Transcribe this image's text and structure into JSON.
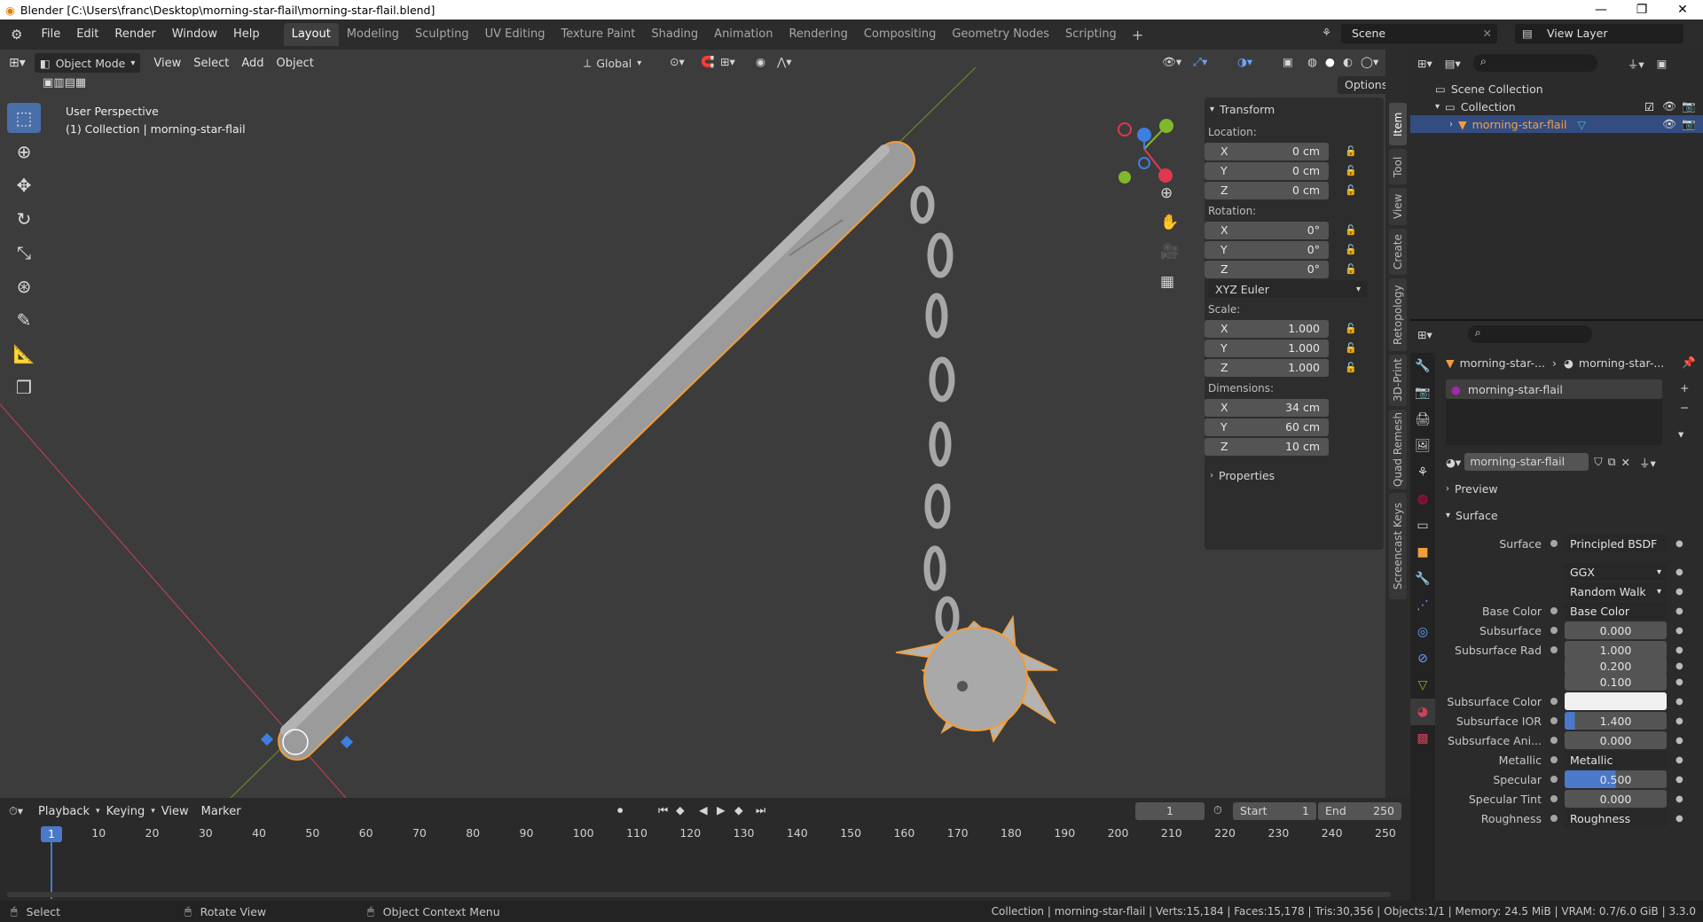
{
  "window": {
    "title": "Blender [C:\\Users\\franc\\Desktop\\morning-star-flail\\morning-star-flail.blend]"
  },
  "menu": [
    "File",
    "Edit",
    "Render",
    "Window",
    "Help"
  ],
  "workspaces": [
    "Layout",
    "Modeling",
    "Sculpting",
    "UV Editing",
    "Texture Paint",
    "Shading",
    "Animation",
    "Rendering",
    "Compositing",
    "Geometry Nodes",
    "Scripting"
  ],
  "active_workspace": "Layout",
  "scene": "Scene",
  "view_layer": "View Layer",
  "viewport": {
    "mode": "Object Mode",
    "menus": [
      "View",
      "Select",
      "Add",
      "Object"
    ],
    "orientation": "Global",
    "options": "Options",
    "overlay_title": "User Perspective",
    "overlay_sub": "(1) Collection | morning-star-flail"
  },
  "npanel": {
    "header": "Transform",
    "location_label": "Location:",
    "location": [
      {
        "axis": "X",
        "value": "0 cm"
      },
      {
        "axis": "Y",
        "value": "0 cm"
      },
      {
        "axis": "Z",
        "value": "0 cm"
      }
    ],
    "rotation_label": "Rotation:",
    "rotation": [
      {
        "axis": "X",
        "value": "0°"
      },
      {
        "axis": "Y",
        "value": "0°"
      },
      {
        "axis": "Z",
        "value": "0°"
      }
    ],
    "rotation_mode": "XYZ Euler",
    "scale_label": "Scale:",
    "scale": [
      {
        "axis": "X",
        "value": "1.000"
      },
      {
        "axis": "Y",
        "value": "1.000"
      },
      {
        "axis": "Z",
        "value": "1.000"
      }
    ],
    "dimensions_label": "Dimensions:",
    "dimensions": [
      {
        "axis": "X",
        "value": "34 cm"
      },
      {
        "axis": "Y",
        "value": "60 cm"
      },
      {
        "axis": "Z",
        "value": "10 cm"
      }
    ],
    "properties": "Properties"
  },
  "side_tabs": [
    "Item",
    "Tool",
    "View",
    "Create",
    "Retopology",
    "3D-Print",
    "Quad Remesh",
    "Screencast Keys"
  ],
  "outliner": {
    "scene_collection": "Scene Collection",
    "collection": "Collection",
    "object": "morning-star-flail"
  },
  "properties": {
    "breadcrumb_obj": "morning-star-...",
    "breadcrumb_mat": "morning-star-...",
    "slot": "morning-star-flail",
    "material": "morning-star-flail",
    "preview": "Preview",
    "surface_section": "Surface",
    "rows": [
      {
        "label": "Surface",
        "value": "Principled BSDF"
      },
      {
        "label": "",
        "value": "GGX"
      },
      {
        "label": "",
        "value": "Random Walk"
      },
      {
        "label": "Base Color",
        "value": "Base Color"
      },
      {
        "label": "Subsurface",
        "value": "0.000"
      },
      {
        "label": "Subsurface Rad",
        "value": "1.000"
      },
      {
        "label": "",
        "value": "0.200"
      },
      {
        "label": "",
        "value": "0.100"
      },
      {
        "label": "Subsurface Color",
        "value": ""
      },
      {
        "label": "Subsurface IOR",
        "value": "1.400"
      },
      {
        "label": "Subsurface Ani...",
        "value": "0.000"
      },
      {
        "label": "Metallic",
        "value": "Metallic"
      },
      {
        "label": "Specular",
        "value": "0.500"
      },
      {
        "label": "Specular Tint",
        "value": "0.000"
      },
      {
        "label": "Roughness",
        "value": "Roughness"
      }
    ]
  },
  "timeline": {
    "menus": [
      "Playback",
      "Keying",
      "View",
      "Marker"
    ],
    "current_frame": "1",
    "start_label": "Start",
    "start": "1",
    "end_label": "End",
    "end": "250",
    "ticks": [
      "1",
      "10",
      "20",
      "30",
      "40",
      "50",
      "60",
      "70",
      "80",
      "90",
      "100",
      "110",
      "120",
      "130",
      "140",
      "150",
      "160",
      "170",
      "180",
      "190",
      "200",
      "210",
      "220",
      "230",
      "240",
      "250"
    ]
  },
  "statusbar": {
    "select": "Select",
    "rotate": "Rotate View",
    "context": "Object Context Menu",
    "stats": "Collection | morning-star-flail | Verts:15,184 | Faces:15,178 | Tris:30,356 | Objects:1/1 | Memory: 24.5 MiB | VRAM: 0.7/6.0 GiB | 3.3.0"
  },
  "colors": {
    "accent": "#4a6fa8",
    "selection": "#f29d3a",
    "x_axis": "#e0384f",
    "y_axis": "#7fb82a",
    "z_axis": "#3d7fe0"
  }
}
